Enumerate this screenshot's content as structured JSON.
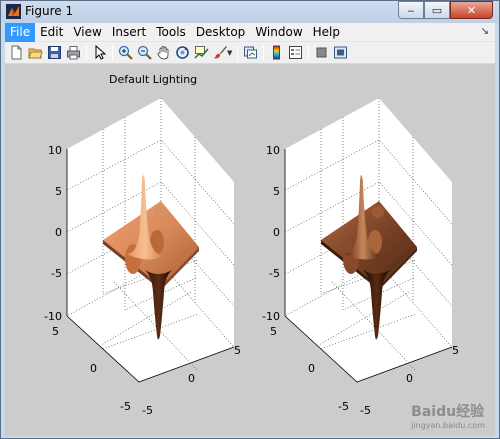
{
  "window": {
    "title": "Figure 1",
    "icon": "matlab-icon",
    "controls": {
      "minimize": "‒",
      "maximize": "▭",
      "close": "✕"
    }
  },
  "menubar": {
    "items": [
      {
        "label": "File",
        "active": true
      },
      {
        "label": "Edit"
      },
      {
        "label": "View"
      },
      {
        "label": "Insert"
      },
      {
        "label": "Tools"
      },
      {
        "label": "Desktop"
      },
      {
        "label": "Window"
      },
      {
        "label": "Help"
      }
    ],
    "dock_arrow": "↘"
  },
  "toolbar": {
    "buttons": [
      "new-figure-icon",
      "open-icon",
      "save-icon",
      "print-icon",
      "edit-plot-icon",
      "zoom-in-icon",
      "zoom-out-icon",
      "pan-icon",
      "rotate-3d-icon",
      "data-cursor-icon",
      "brush-icon",
      "link-plot-icon",
      "colorbar-icon",
      "legend-icon",
      "hide-plot-tools-icon",
      "show-plot-tools-icon"
    ]
  },
  "figure": {
    "title": "Default Lighting",
    "background": "#cccccc",
    "left_plot": {
      "z_ticks": [
        "10",
        "5",
        "0",
        "-5",
        "-10"
      ],
      "y_ticks": [
        "5",
        "0",
        "-5"
      ],
      "x_ticks": [
        "5",
        "0",
        "-5"
      ],
      "surface_color": "#d98a55"
    },
    "right_plot": {
      "z_ticks": [
        "10",
        "5",
        "0",
        "-5",
        "-10"
      ],
      "y_ticks": [
        "5",
        "0",
        "-5"
      ],
      "x_ticks": [
        "5",
        "0",
        "-5"
      ],
      "surface_color": "#7a4226"
    }
  },
  "watermark": {
    "text": "Baidu经验",
    "sub": "jingyan.baidu.com"
  }
}
